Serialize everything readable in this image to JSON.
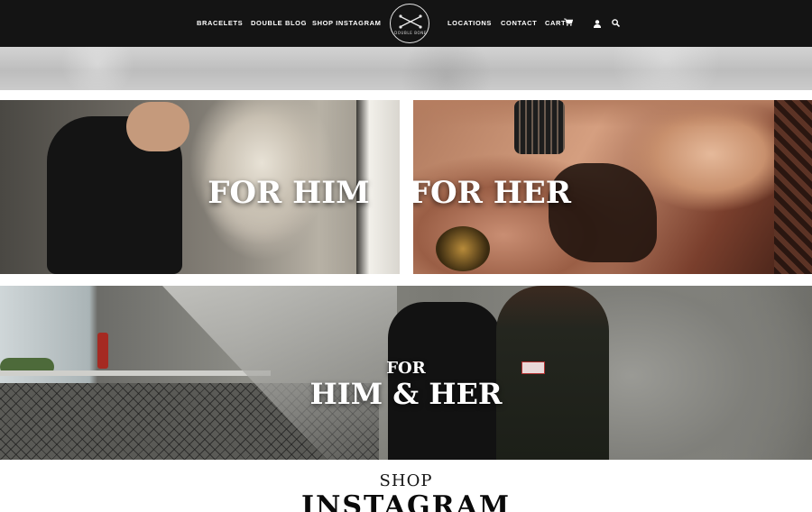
{
  "nav": {
    "left_items": [
      {
        "label": "BRACELETS"
      },
      {
        "label": "DOUBLE BLOG"
      },
      {
        "label": "SHOP INSTAGRAM"
      }
    ],
    "logo_text": "DOUBLE BONE",
    "right_items": [
      {
        "label": "LOCATIONS"
      },
      {
        "label": "CONTACT"
      }
    ],
    "cart_label": "CART",
    "icons": [
      "cart-icon",
      "user-icon",
      "search-icon"
    ]
  },
  "tiles": {
    "him": {
      "title": "FOR HIM"
    },
    "her": {
      "title": "FOR HER"
    },
    "both": {
      "line1": "FOR",
      "line2": "HIM & HER"
    }
  },
  "shop": {
    "label": "SHOP",
    "heading": "INSTAGRAM"
  },
  "colors": {
    "nav_background": "#141414",
    "nav_text": "#ffffff",
    "heading_text": "#0a0a0a"
  }
}
